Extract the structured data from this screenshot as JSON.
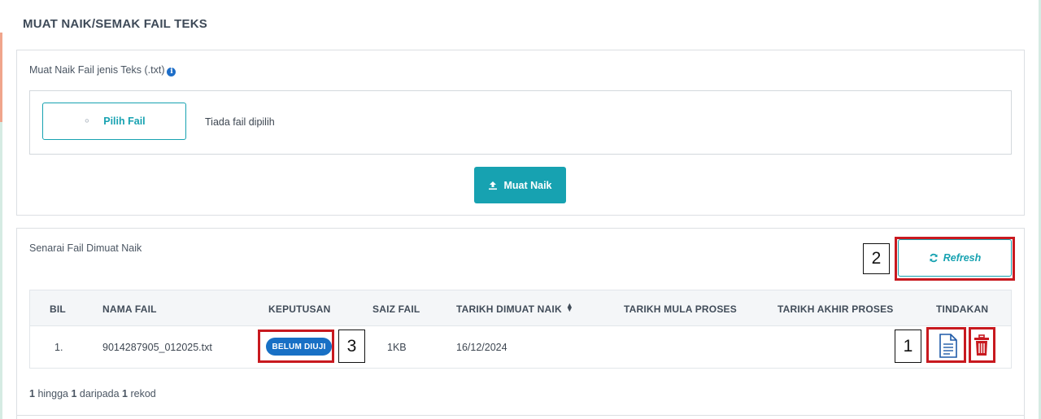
{
  "page": {
    "title": "MUAT NAIK/SEMAK FAIL TEKS"
  },
  "upload": {
    "label": "Muat Naik Fail jenis Teks (.txt)",
    "info_icon": "info-icon",
    "choose_button": "Pilih Fail",
    "no_file_text": "Tiada fail dipilih",
    "upload_button": "Muat Naik"
  },
  "list": {
    "title": "Senarai Fail Dimuat Naik",
    "refresh_button": "Refresh",
    "columns": [
      "BIL",
      "NAMA FAIL",
      "KEPUTUSAN",
      "SAIZ FAIL",
      "TARIKH DIMUAT NAIK",
      "TARIKH MULA PROSES",
      "TARIKH AKHIR PROSES",
      "TINDAKAN"
    ],
    "rows": [
      {
        "bil": "1.",
        "nama_fail": "9014287905_012025.txt",
        "keputusan": "BELUM DIUJI",
        "saiz_fail": "1KB",
        "tarikh_dimuat_naik": "16/12/2024",
        "tarikh_mula_proses": "",
        "tarikh_akhir_proses": ""
      }
    ],
    "record_info": {
      "from": "1",
      "word_to": "hingga",
      "to": "1",
      "word_of": "daripada",
      "total": "1",
      "word_records": "rekod"
    }
  },
  "annotations": {
    "one": "1",
    "two": "2",
    "three": "3"
  },
  "colors": {
    "accent": "#17a2b1",
    "badge": "#1870c5",
    "view_icon": "#1e5aa8",
    "delete_icon": "#c8191f",
    "annotation_box": "#c8191f"
  }
}
